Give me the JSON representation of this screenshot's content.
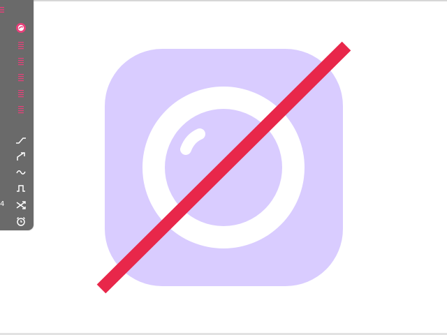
{
  "colors": {
    "panel_bg": "#6a6a6a",
    "accent_pink": "#e8407a",
    "icon_lavender": "#d9ccff",
    "slash_red": "#e8274a",
    "white": "#ffffff"
  },
  "toolbar": {
    "menu_icon": "hamburger-icon",
    "top_tool_icon": "color-wheel-icon",
    "list_items": [
      {
        "icon": "lines-icon"
      },
      {
        "icon": "lines-icon"
      },
      {
        "icon": "lines-icon"
      },
      {
        "icon": "lines-icon"
      },
      {
        "icon": "lines-icon"
      }
    ],
    "wave_tools": [
      {
        "icon": "ramp-icon"
      },
      {
        "icon": "arrow-up-right-icon"
      },
      {
        "icon": "sine-wave-icon"
      },
      {
        "icon": "square-pulse-icon"
      },
      {
        "icon": "shuffle-icon"
      },
      {
        "icon": "alarm-clock-icon"
      }
    ],
    "side_number": "4"
  },
  "artwork": {
    "subject": "camera-app-icon",
    "overlay": "prohibited-slash-icon"
  }
}
